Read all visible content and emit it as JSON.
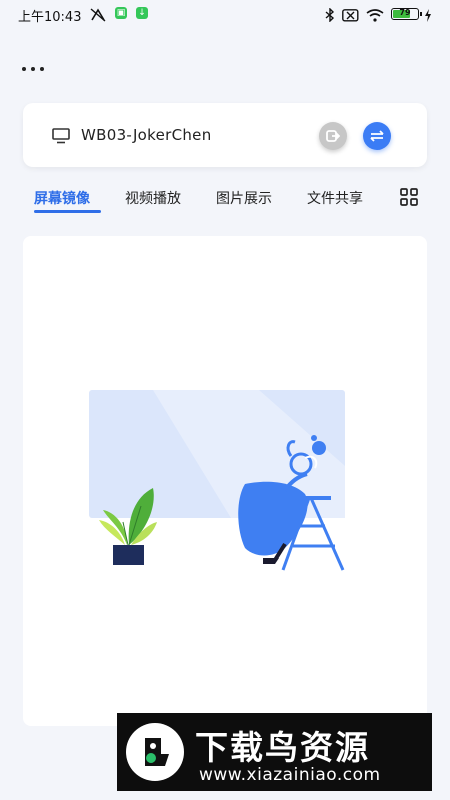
{
  "status_bar": {
    "time": "上午10:43",
    "battery_level": 79,
    "battery_text": "79",
    "icons": [
      "data-off-icon",
      "app-notification-icon",
      "download-notification-icon",
      "bluetooth-icon",
      "sim-off-icon",
      "wifi-icon",
      "battery-icon",
      "charging-icon"
    ]
  },
  "header": {
    "more_icon": "more-dots-icon"
  },
  "device": {
    "name": "WB03-JokerChen",
    "device_icon": "monitor-icon",
    "disconnect_icon": "disconnect-icon",
    "switch_icon": "switch-arrows-icon"
  },
  "tabs": [
    {
      "label": "屏幕镜像",
      "active": true
    },
    {
      "label": "视频播放",
      "active": false
    },
    {
      "label": "图片展示",
      "active": false
    },
    {
      "label": "文件共享",
      "active": false
    }
  ],
  "tabs_more_icon": "grid-icon",
  "colors": {
    "accent": "#2f6ee8",
    "background": "#f3f5fa",
    "card": "#ffffff",
    "illustration_blue": "#3f7ff2",
    "illustration_light": "#dbe6fb"
  },
  "watermark": {
    "title": "下载鸟资源",
    "url": "www.xiazainiao.com"
  }
}
